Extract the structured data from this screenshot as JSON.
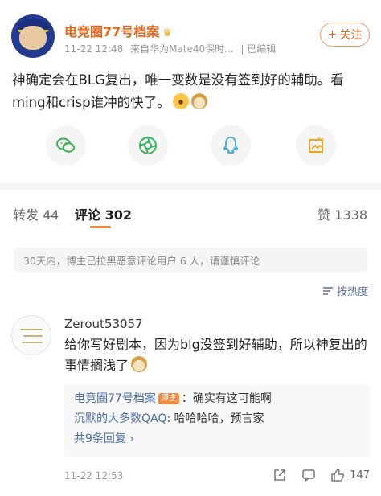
{
  "post": {
    "author": "电竞圈77号档案",
    "time": "11-22 12:48",
    "source": "来自华为Mate40保时...",
    "edited": "已编辑",
    "follow_label": "关注",
    "text": "神确定会在BLG复出，唯一变数是没有签到好的辅助。看ming和crisp谁冲的快了。"
  },
  "share": {
    "icons": [
      "wechat-icon",
      "moments-icon",
      "qq-icon",
      "qzone-icon"
    ]
  },
  "tabs": {
    "repost_label": "转发",
    "repost_count": "44",
    "comment_label": "评论",
    "comment_count": "302",
    "like_label": "赞",
    "like_count": "1338"
  },
  "notice": "30天内，博主已拉黑恶意评论用户 6 人，请谨慎评论",
  "sort_label": "按热度",
  "comment": {
    "author": "Zerout53057",
    "text": "给你写好剧本，因为blg没签到好辅助，所以神复出的事情搁浅了",
    "replies": [
      {
        "name": "电竞圈77号档案",
        "badge": "博主",
        "text": "：确实有这可能啊"
      },
      {
        "name": "沉默的大多数QAQ",
        "badge": "",
        "text": ": 哈哈哈哈，预言家"
      }
    ],
    "reply_count_label": "共9条回复",
    "time": "11-22 12:53",
    "likes": "147"
  },
  "colors": {
    "accent": "#e8651e",
    "link": "#4b6ea9",
    "tab_underline": "#f08a3c"
  }
}
